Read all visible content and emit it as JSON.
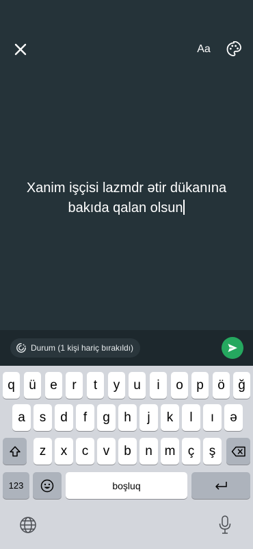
{
  "status": {
    "line1": "Xanim işçisi lazmdr ətir dükanına",
    "line2": "bakıda qalan olsun"
  },
  "toolbar": {
    "font_label": "Aa"
  },
  "audience": {
    "label": "Durum (1 kişi hariç bırakıldı)"
  },
  "keyboard": {
    "row1": [
      "q",
      "ü",
      "e",
      "r",
      "t",
      "y",
      "u",
      "i",
      "o",
      "p",
      "ö",
      "ğ"
    ],
    "row2": [
      "a",
      "s",
      "d",
      "f",
      "g",
      "h",
      "j",
      "k",
      "l",
      "ı",
      "ə"
    ],
    "row3": [
      "z",
      "x",
      "c",
      "v",
      "b",
      "n",
      "m",
      "ç",
      "ş"
    ],
    "numbers_label": "123",
    "space_label": "boşluq"
  },
  "colors": {
    "background": "#253339",
    "send": "#25a85f",
    "keyboard": "#d3d6dc"
  },
  "icons": [
    "close-icon",
    "font-icon",
    "palette-icon",
    "status-ring-icon",
    "send-icon",
    "shift-icon",
    "backspace-icon",
    "emoji-icon",
    "return-icon",
    "globe-icon",
    "microphone-icon"
  ]
}
